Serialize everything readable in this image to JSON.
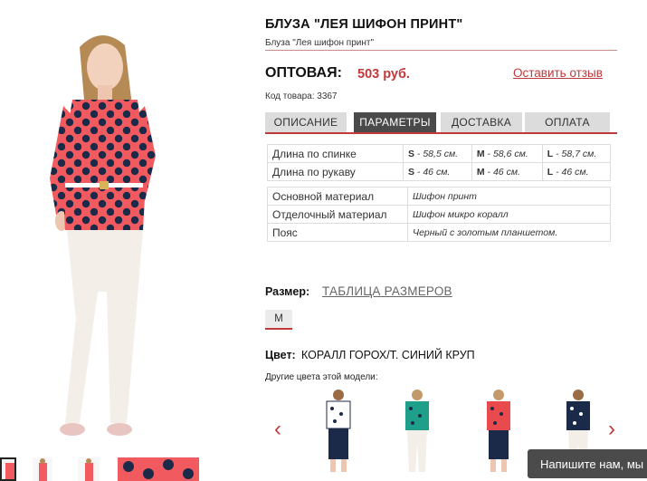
{
  "product": {
    "title": "БЛУЗА \"ЛЕЯ ШИФОН ПРИНТ\"",
    "subtitle": "Блуза \"Лея шифон принт\"",
    "price_label": "ОПТОВАЯ:",
    "price_value": "503 руб.",
    "review_link": "Оставить отзыв",
    "sku": "Код товара: 3367"
  },
  "tabs": [
    "ОПИСАНИЕ",
    "ПАРАМЕТРЫ",
    "ДОСТАВКА",
    "ОПЛАТА"
  ],
  "active_tab": "ПАРАМЕТРЫ",
  "measurements": {
    "rows": [
      {
        "name": "Длина по спинке",
        "values": [
          {
            "size": "S",
            "text": " - 58,5 см."
          },
          {
            "size": "M",
            "text": " - 58,6 см."
          },
          {
            "size": "L",
            "text": " - 58,7 см."
          }
        ]
      },
      {
        "name": "Длина по рукаву",
        "values": [
          {
            "size": "S",
            "text": " - 46 см."
          },
          {
            "size": "M",
            "text": " - 46 см."
          },
          {
            "size": "L",
            "text": " - 46 см."
          }
        ]
      }
    ]
  },
  "materials": {
    "rows": [
      {
        "name": "Основной материал",
        "value": "Шифон принт"
      },
      {
        "name": "Отделочный материал",
        "value": "Шифон микро коралл"
      },
      {
        "name": "Пояс",
        "value": "Черный с золотым планшетом."
      }
    ]
  },
  "size": {
    "label": "Размер:",
    "table_link": "ТАБЛИЦА РАЗМЕРОВ",
    "selected": "M"
  },
  "color": {
    "label": "Цвет:",
    "value": "КОРАЛЛ ГОРОХ/Т. СИНИЙ КРУП",
    "other_label": "Другие цвета этой модели:"
  },
  "variant_colors": [
    "#ffffff",
    "#1f9e8a",
    "#e94a4e",
    "#ffffff"
  ],
  "icons": {
    "prev": "chevron-left-icon",
    "next": "chevron-right-icon"
  },
  "chat": {
    "label": "Напишите нам, мы"
  },
  "colors": {
    "accent": "#c0393b",
    "blouse": "#f15a5e",
    "dots": "#1c2a4a",
    "tab_active": "#4a4a4a"
  }
}
